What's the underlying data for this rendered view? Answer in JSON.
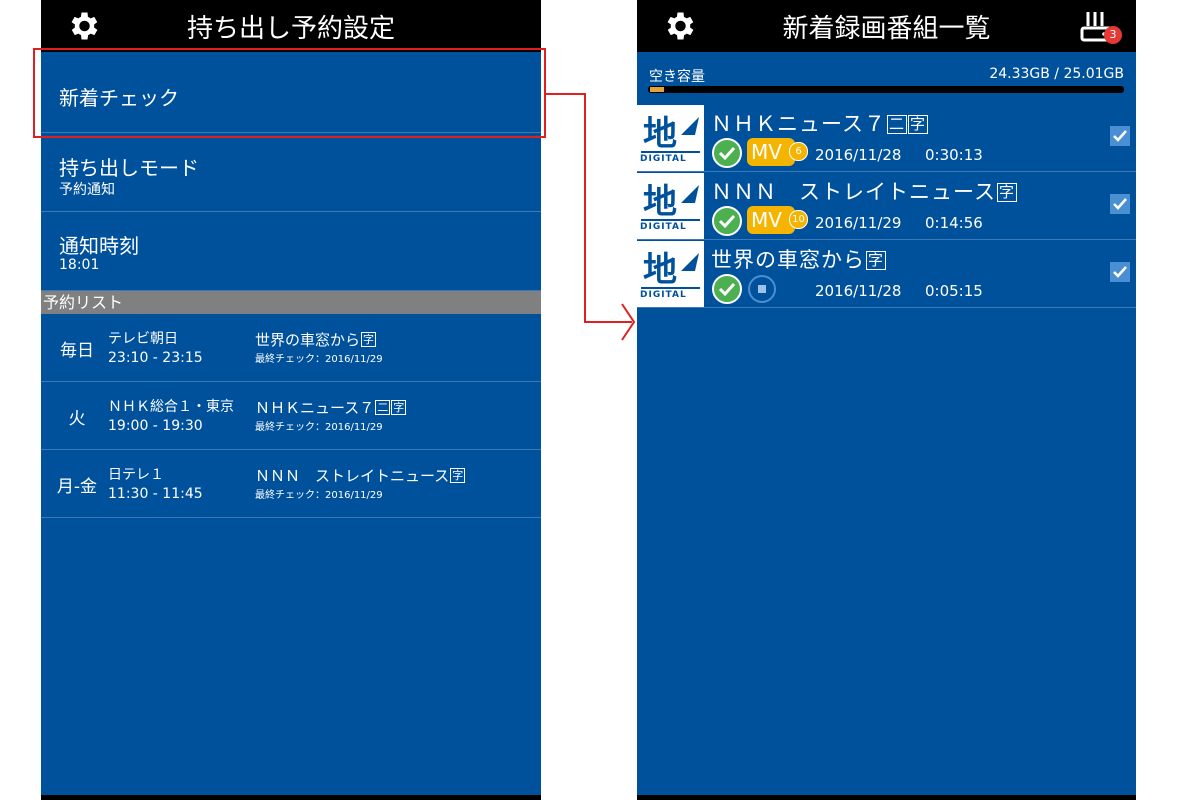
{
  "left": {
    "title": "持ち出し予約設定",
    "settings": [
      {
        "label": "新着チェック",
        "sub": ""
      },
      {
        "label": "持ち出しモード",
        "sub": "予約通知"
      },
      {
        "label": "通知時刻",
        "sub": "18:01"
      }
    ],
    "section_label": "予約リスト",
    "reservations": [
      {
        "day": "毎日",
        "channel": "テレビ朝日",
        "time": "23:10 - 23:15",
        "program": "世界の車窓から",
        "tag": "字",
        "last_check": "最終チェック：2016/11/29"
      },
      {
        "day": "火",
        "channel": "ＮＨＫ総合１・東京",
        "time": "19:00 - 19:30",
        "program": "ＮＨＫニュース７",
        "tag2": "二",
        "tag": "字",
        "last_check": "最終チェック：2016/11/29"
      },
      {
        "day": "月-金",
        "channel": "日テレ１",
        "time": "11:30 - 11:45",
        "program": "ＮＮＮ　ストレイトニュース",
        "tag": "字",
        "last_check": "最終チェック：2016/11/29"
      }
    ]
  },
  "right": {
    "title": "新着録画番組一覧",
    "router_badge": "3",
    "storage": {
      "label": "空き容量",
      "value": "24.33GB / 25.01GB",
      "used_fraction": 0.03
    },
    "programs": [
      {
        "title": "ＮＨＫニュース７",
        "tag2": "二",
        "tag": "字",
        "mv_label": "MV",
        "mv_count": "6",
        "date": "2016/11/28",
        "duration": "0:30:13",
        "checked": true,
        "status": "mv"
      },
      {
        "title": "ＮＮＮ　ストレイトニュース",
        "tag": "字",
        "mv_label": "MV",
        "mv_count": "10",
        "date": "2016/11/29",
        "duration": "0:14:56",
        "checked": true,
        "status": "mv"
      },
      {
        "title": "世界の車窓から",
        "tag": "字",
        "date": "2016/11/28",
        "duration": "0:05:15",
        "checked": true,
        "status": "stop"
      }
    ],
    "logo_text": "DIGITAL"
  },
  "colors": {
    "panel": "#00519c",
    "bar": "#000000",
    "accent": "#f5b400",
    "ok": "#4caf50",
    "callout": "#e02020"
  }
}
